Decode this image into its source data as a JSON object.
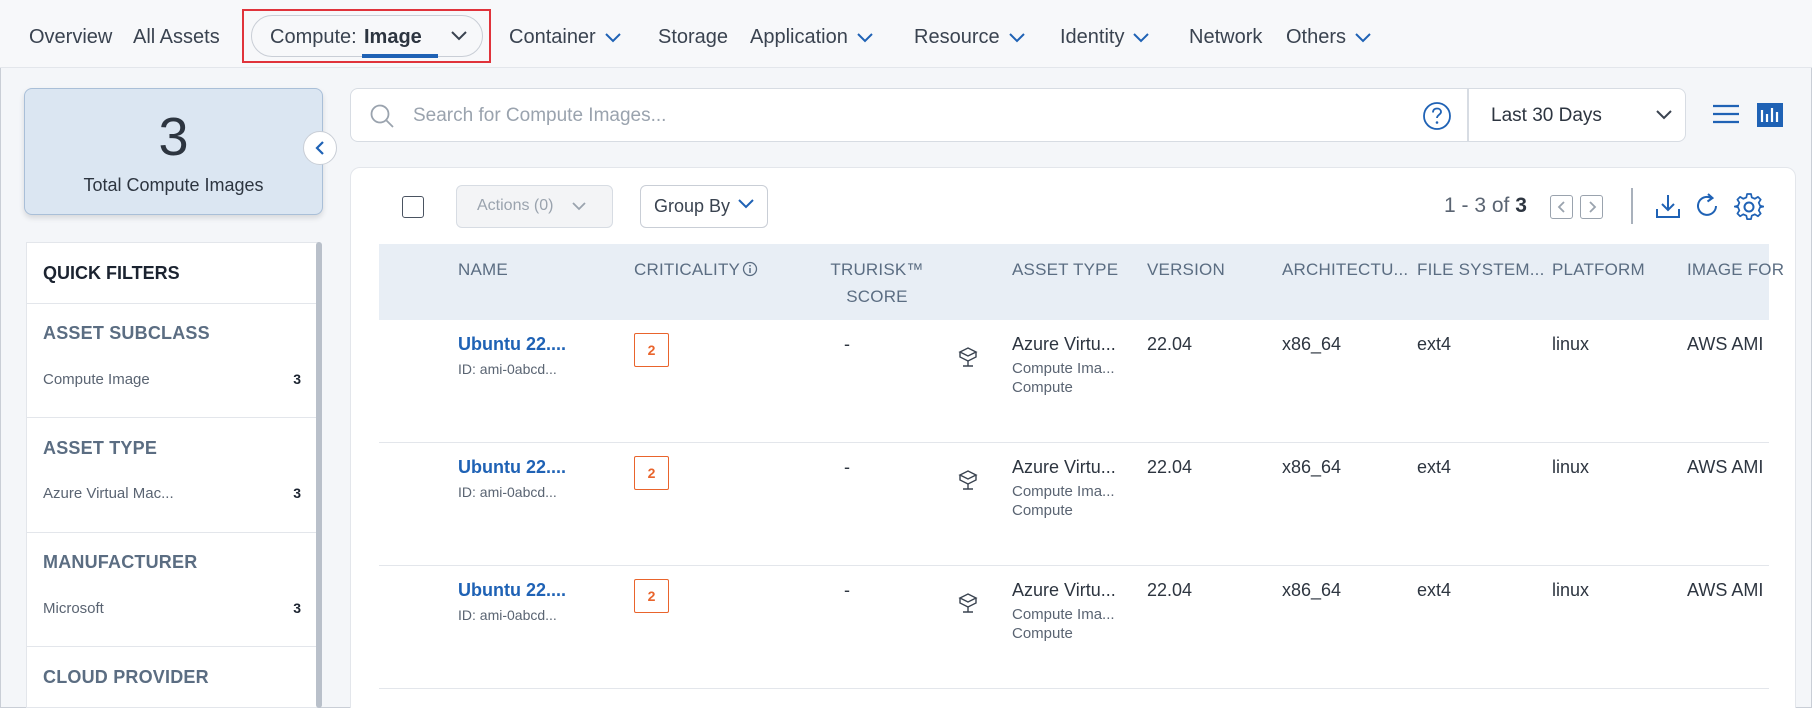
{
  "nav": {
    "overview": "Overview",
    "all_assets": "All Assets",
    "compute_label": "Compute:",
    "compute_value": "Image",
    "container": "Container",
    "storage": "Storage",
    "application": "Application",
    "resource": "Resource",
    "identity": "Identity",
    "network": "Network",
    "others": "Others"
  },
  "summary": {
    "count": "3",
    "caption": "Total Compute Images"
  },
  "quick_filters": {
    "title": "QUICK FILTERS",
    "groups": [
      {
        "heading": "ASSET SUBCLASS",
        "item": "Compute Image",
        "count": "3"
      },
      {
        "heading": "ASSET TYPE",
        "item": "Azure Virtual Mac...",
        "count": "3"
      },
      {
        "heading": "MANUFACTURER",
        "item": "Microsoft",
        "count": "3"
      },
      {
        "heading": "CLOUD PROVIDER"
      }
    ]
  },
  "search": {
    "placeholder": "Search for Compute Images..."
  },
  "date_range": "Last 30 Days",
  "toolbar": {
    "actions": "Actions (0)",
    "group_by": "Group By",
    "pager_prefix": "1 - 3 of",
    "pager_total": "3"
  },
  "table": {
    "headers": {
      "name": "NAME",
      "criticality": "CRITICALITY",
      "trurisk_1": "TRURISK™",
      "trurisk_2": "SCORE",
      "asset_type": "ASSET TYPE",
      "version": "VERSION",
      "architecture": "ARCHITECTU...",
      "file_system": "FILE SYSTEM...",
      "platform": "PLATFORM",
      "image_format": "IMAGE FOR"
    },
    "rows": [
      {
        "name": "Ubuntu 22....",
        "id": "ID: ami-0abcd...",
        "criticality": "2",
        "trurisk": "-",
        "asset_type": "Azure Virtu...",
        "asset_subclass": "Compute Ima...",
        "asset_class": "Compute",
        "version": "22.04",
        "architecture": "x86_64",
        "file_system": "ext4",
        "platform": "linux",
        "image_format": "AWS AMI"
      },
      {
        "name": "Ubuntu 22....",
        "id": "ID: ami-0abcd...",
        "criticality": "2",
        "trurisk": "-",
        "asset_type": "Azure Virtu...",
        "asset_subclass": "Compute Ima...",
        "asset_class": "Compute",
        "version": "22.04",
        "architecture": "x86_64",
        "file_system": "ext4",
        "platform": "linux",
        "image_format": "AWS AMI"
      },
      {
        "name": "Ubuntu 22....",
        "id": "ID: ami-0abcd...",
        "criticality": "2",
        "trurisk": "-",
        "asset_type": "Azure Virtu...",
        "asset_subclass": "Compute Ima...",
        "asset_class": "Compute",
        "version": "22.04",
        "architecture": "x86_64",
        "file_system": "ext4",
        "platform": "linux",
        "image_format": "AWS AMI"
      }
    ]
  },
  "colors": {
    "accent": "#1f62b5",
    "criticality": "#e9642c",
    "highlight_border": "#e0333b"
  }
}
